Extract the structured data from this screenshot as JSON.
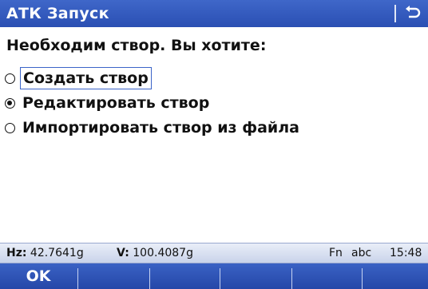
{
  "window": {
    "title": "АТК Запуск",
    "back_icon": "back-arrow-icon"
  },
  "dialog": {
    "question": "Необходим створ. Вы  хотите:",
    "options": [
      {
        "label": "Создать створ",
        "selected": false,
        "focused": true
      },
      {
        "label": "Редактировать створ",
        "selected": true,
        "focused": false
      },
      {
        "label": "Импортировать створ из файла",
        "selected": false,
        "focused": false
      }
    ]
  },
  "status": {
    "hz_label": "Hz:",
    "hz_value": "42.7641g",
    "v_label": "V:",
    "v_value": "100.4087g",
    "fn": "Fn",
    "input_mode": "abc",
    "time": "15:48"
  },
  "softkeys": {
    "f1": "OK",
    "f2": "",
    "f3": "",
    "f4": "",
    "f5": "",
    "f6": ""
  },
  "colors": {
    "titlebar": "#2f56bb",
    "softkeys": "#2f56bb",
    "statusbar": "#d6def0"
  }
}
